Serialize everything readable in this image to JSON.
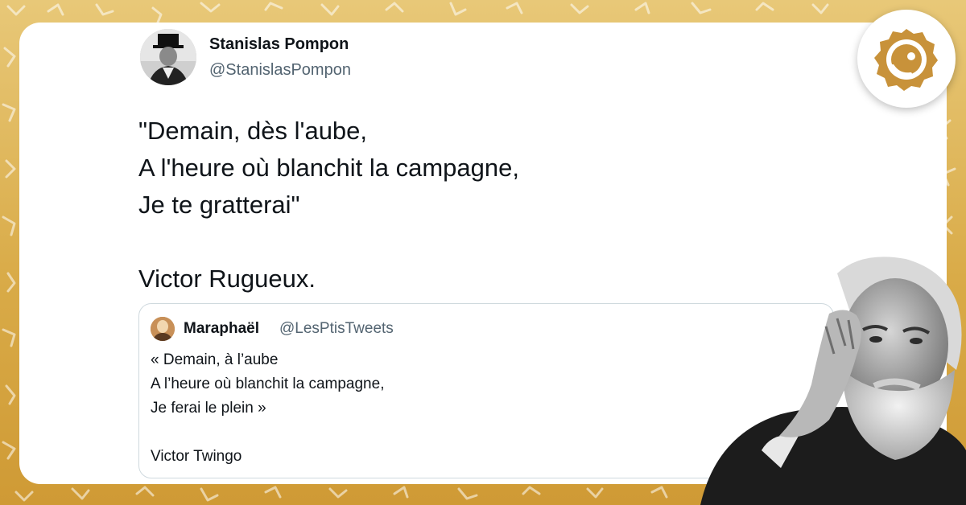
{
  "tweet": {
    "author_name": "Stanislas Pompon",
    "author_handle": "@StanislasPompon",
    "lines": [
      "\"Demain, dès l'aube,",
      "A l'heure où blanchit la campagne,",
      "Je te gratterai\"",
      "",
      "Victor Rugueux."
    ]
  },
  "quoted_tweet": {
    "author_name": "Maraphaël",
    "author_handle": "@LesPtisTweets",
    "lines": [
      "« Demain, à l’aube",
      "A l’heure où blanchit la campagne,",
      "Je ferai le plein »",
      "",
      "Victor Twingo"
    ]
  },
  "icons": {
    "brand_logo": "seal-bird-logo-icon",
    "author_avatar": "top-hat-man-avatar",
    "quoted_avatar": "profile-avatar",
    "portrait": "bearded-man-portrait"
  },
  "colors": {
    "background": "#d9ab48",
    "card": "#ffffff",
    "text": "#0f1419",
    "secondary_text": "#536471",
    "quote_border": "#cfd9de",
    "logo_gold": "#c8923a"
  }
}
